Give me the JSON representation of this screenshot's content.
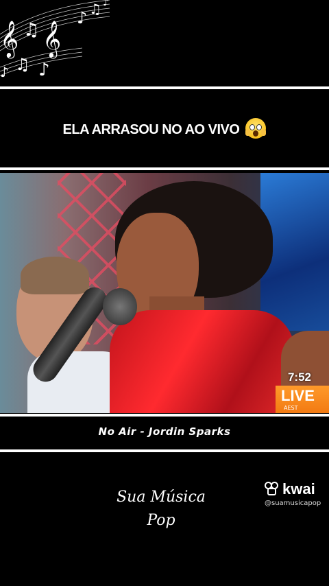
{
  "overlay": {
    "caption": "ELA ARRASOU NO AO VIVO",
    "caption_emoji": "face-screaming-in-fear-icon",
    "song_title": "No Air - Jordin Sparks",
    "brand_line1": "Sua Música",
    "brand_line2": "Pop"
  },
  "video": {
    "time": "7:52",
    "live_label": "LIVE",
    "live_sub": "AEST"
  },
  "watermark": {
    "app": "kwai",
    "handle": "@suamusicapop"
  },
  "colors": {
    "background": "#000000",
    "dress": "#e3141c",
    "live_badge": "#f28a1a"
  }
}
